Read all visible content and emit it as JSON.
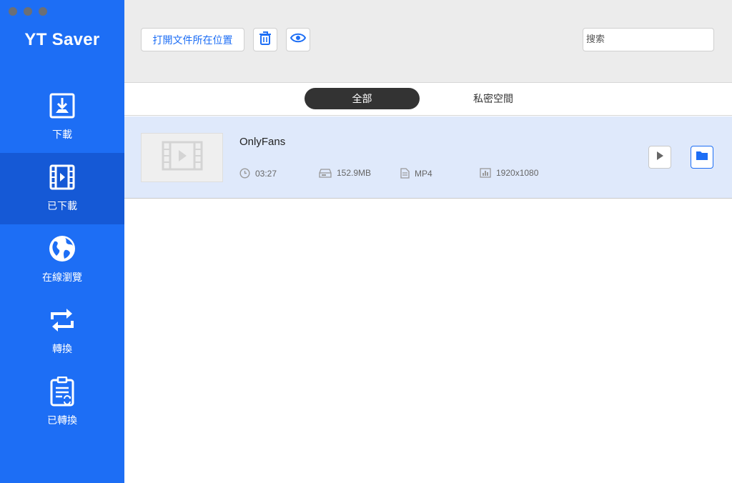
{
  "app": {
    "brand": "YT Saver"
  },
  "sidebar": {
    "items": [
      {
        "label": "下載",
        "icon": "download-icon"
      },
      {
        "label": "已下載",
        "icon": "film-icon"
      },
      {
        "label": "在線瀏覽",
        "icon": "globe-icon"
      },
      {
        "label": "轉換",
        "icon": "convert-icon"
      },
      {
        "label": "已轉換",
        "icon": "converted-doc-icon"
      }
    ],
    "active_index": 1
  },
  "toolbar": {
    "open_location_label": "打開文件所在位置",
    "delete_icon": "trash-icon",
    "preview_icon": "eye-icon",
    "search_placeholder": "搜索"
  },
  "tabs": [
    {
      "label": "全部",
      "active": true
    },
    {
      "label": "私密空間",
      "active": false
    }
  ],
  "items": [
    {
      "title": "OnlyFans",
      "duration": "03:27",
      "size": "152.9MB",
      "format": "MP4",
      "resolution": "1920x1080"
    }
  ],
  "colors": {
    "accent": "#1d6ef5",
    "sidebar_active": "#1559d6",
    "row_selected": "#dfe9fb",
    "tab_active": "#333333"
  }
}
